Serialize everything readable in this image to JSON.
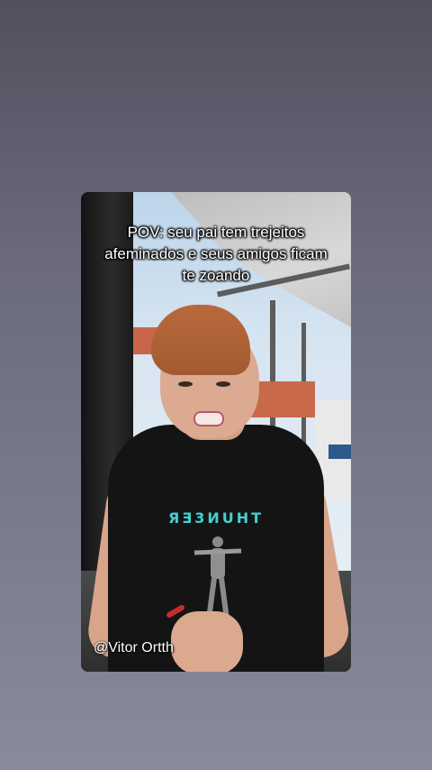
{
  "video": {
    "caption": "POV: seu pai tem trejeitos afeminados e seus amigos ficam te zoando",
    "shirt_text": "ЯƎ3ИUHT",
    "watermark": "@Vitor Ortth"
  },
  "colors": {
    "shirt_print": "#3fd2d0",
    "background_top": "#50505e",
    "background_bottom": "#8a8a9c"
  }
}
